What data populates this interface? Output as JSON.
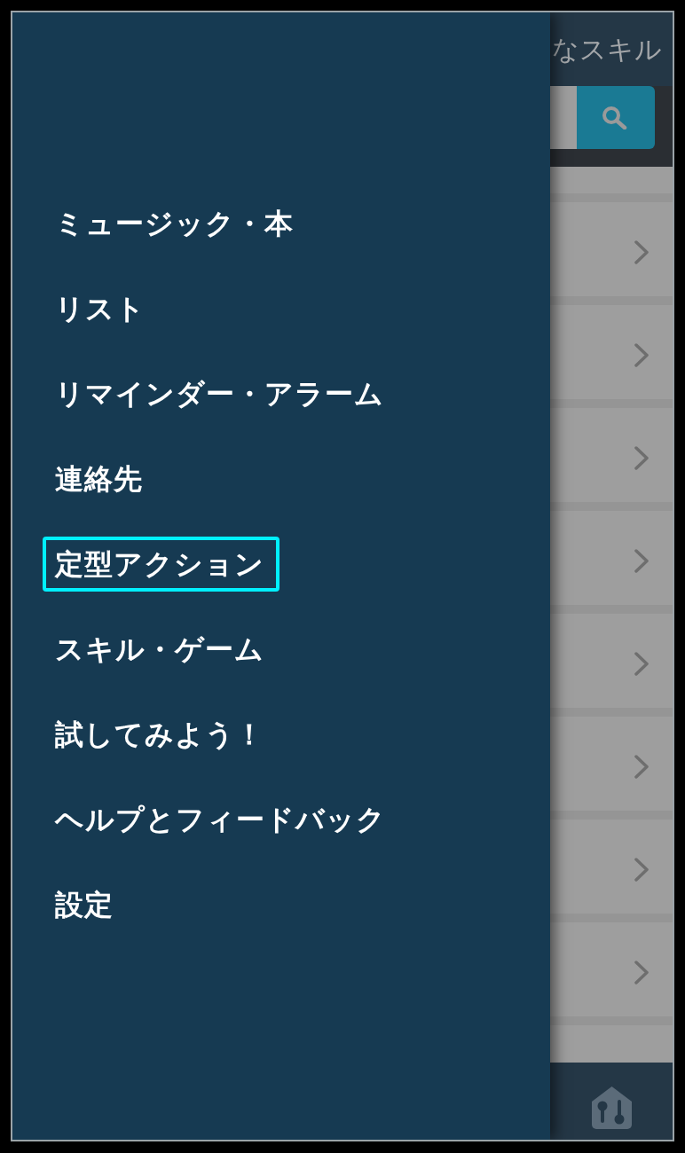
{
  "drawer": {
    "items": [
      {
        "label": "ミュージック・本",
        "focused": false
      },
      {
        "label": "リスト",
        "focused": false
      },
      {
        "label": "リマインダー・アラーム",
        "focused": false
      },
      {
        "label": "連絡先",
        "focused": false
      },
      {
        "label": "定型アクション",
        "focused": true
      },
      {
        "label": "スキル・ゲーム",
        "focused": false
      },
      {
        "label": "試してみよう！",
        "focused": false
      },
      {
        "label": "ヘルプとフィードバック",
        "focused": false
      },
      {
        "label": "設定",
        "focused": false
      }
    ]
  },
  "behind_drawer": {
    "header_title": "なスキル"
  }
}
